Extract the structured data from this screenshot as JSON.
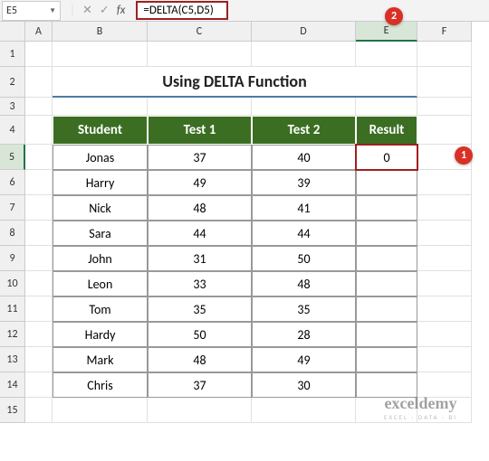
{
  "nameBox": "E5",
  "formula": "=DELTA(C5,D5)",
  "colHeads": [
    "A",
    "B",
    "C",
    "D",
    "E",
    "F"
  ],
  "rowHeads": [
    "1",
    "2",
    "3",
    "4",
    "5",
    "6",
    "7",
    "8",
    "9",
    "10",
    "11",
    "12",
    "13",
    "14",
    "15"
  ],
  "title": "Using DELTA Function",
  "headers": {
    "student": "Student",
    "t1": "Test 1",
    "t2": "Test 2",
    "res": "Result"
  },
  "rows": [
    {
      "s": "Jonas",
      "a": "37",
      "b": "40",
      "r": "0"
    },
    {
      "s": "Harry",
      "a": "49",
      "b": "39",
      "r": ""
    },
    {
      "s": "Nick",
      "a": "48",
      "b": "41",
      "r": ""
    },
    {
      "s": "Sara",
      "a": "44",
      "b": "44",
      "r": ""
    },
    {
      "s": "John",
      "a": "31",
      "b": "50",
      "r": ""
    },
    {
      "s": "Leon",
      "a": "33",
      "b": "48",
      "r": ""
    },
    {
      "s": "Tom",
      "a": "35",
      "b": "35",
      "r": ""
    },
    {
      "s": "Hardy",
      "a": "50",
      "b": "28",
      "r": ""
    },
    {
      "s": "Mark",
      "a": "48",
      "b": "49",
      "r": ""
    },
    {
      "s": "Chris",
      "a": "37",
      "b": "30",
      "r": ""
    }
  ],
  "callouts": {
    "one": "1",
    "two": "2"
  },
  "wm": {
    "title": "exceldemy",
    "sub": "EXCEL · DATA · BI"
  },
  "chart_data": {
    "type": "table",
    "title": "Using DELTA Function",
    "columns": [
      "Student",
      "Test 1",
      "Test 2",
      "Result"
    ],
    "data": [
      [
        "Jonas",
        37,
        40,
        0
      ],
      [
        "Harry",
        49,
        39,
        null
      ],
      [
        "Nick",
        48,
        41,
        null
      ],
      [
        "Sara",
        44,
        44,
        null
      ],
      [
        "John",
        31,
        50,
        null
      ],
      [
        "Leon",
        33,
        48,
        null
      ],
      [
        "Tom",
        35,
        35,
        null
      ],
      [
        "Hardy",
        50,
        28,
        null
      ],
      [
        "Mark",
        48,
        49,
        null
      ],
      [
        "Chris",
        37,
        30,
        null
      ]
    ]
  }
}
